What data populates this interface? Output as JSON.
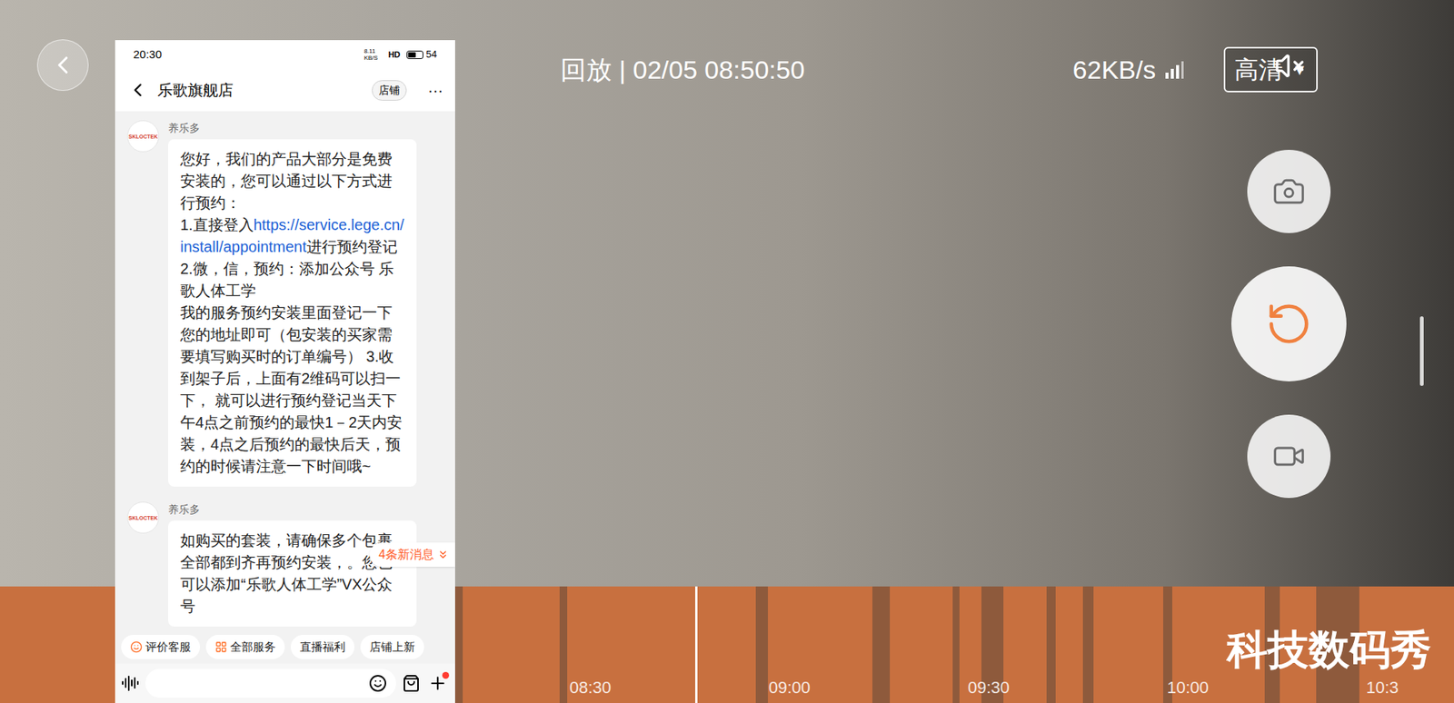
{
  "player": {
    "mode": "回放 | 02/05 08:50:50",
    "speed": "62KB/s",
    "quality": "高清",
    "quality_arrow": "▼",
    "muted": true
  },
  "controls": [
    {
      "name": "snapshot",
      "kind": "camera",
      "selected": false
    },
    {
      "name": "replay",
      "kind": "replay",
      "selected": true
    },
    {
      "name": "record",
      "kind": "video",
      "selected": false
    }
  ],
  "timeline": {
    "ticks": [
      "08:30",
      "09:00",
      "09:30",
      "10:00",
      "10:3"
    ],
    "playhead": 0.478,
    "gaps": [
      {
        "start": 0.31,
        "end": 0.318
      },
      {
        "start": 0.385,
        "end": 0.39
      },
      {
        "start": 0.52,
        "end": 0.528
      },
      {
        "start": 0.6,
        "end": 0.612
      },
      {
        "start": 0.655,
        "end": 0.66
      },
      {
        "start": 0.675,
        "end": 0.69
      },
      {
        "start": 0.72,
        "end": 0.726
      },
      {
        "start": 0.745,
        "end": 0.752
      },
      {
        "start": 0.8,
        "end": 0.806
      },
      {
        "start": 0.87,
        "end": 0.88
      },
      {
        "start": 0.905,
        "end": 0.935
      }
    ]
  },
  "watermark": "科技数码秀",
  "chat": {
    "status_bar": {
      "time": "20:30",
      "net_speed": "8.11 KB/S",
      "hd": "HD",
      "battery": "54"
    },
    "title": "乐歌旗舰店",
    "shop_button": "店铺",
    "more": "···",
    "messages": [
      {
        "sender": "养乐多",
        "avatar": "SKLOCTEK",
        "parts": [
          {
            "text": "您好，我们的产品大部分是免费安装的，您可以通过以下方式进行预约：\n1.直接登入",
            "link": false
          },
          {
            "text": "https://service.lege.cn/install/appointment",
            "link": true
          },
          {
            "text": "进行预约登记\n2.微，信，预约：添加公众号 乐歌人体工学\n我的服务预约安装里面登记一下您的地址即可（包安装的买家需要填写购买时的订单编号） 3.收到架子后，上面有2维码可以扫一下， 就可以进行预约登记当天下午4点之前预约的最快1－2天内安装，4点之后预约的最快后天，预约的时候请注意一下时间哦~",
            "link": false
          }
        ]
      },
      {
        "sender": "养乐多",
        "avatar": "SKLOCTEK",
        "parts": [
          {
            "text": "如购买的套装，请确保多个包裹全部都到齐再预约安装，。您也可以添加“乐歌人体工学”VX公众号",
            "link": false
          }
        ]
      }
    ],
    "new_messages": "4条新消息",
    "quick_actions": [
      {
        "label": "评价客服",
        "kind": "smile"
      },
      {
        "label": "全部服务",
        "kind": "grid"
      },
      {
        "label": "直播福利",
        "kind": "plain"
      },
      {
        "label": "店铺上新",
        "kind": "plain"
      }
    ],
    "plus_badge": true
  }
}
